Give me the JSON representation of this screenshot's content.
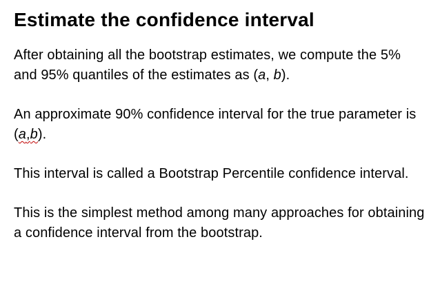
{
  "title": "Estimate the confidence interval",
  "paragraphs": {
    "p1": {
      "before": "After obtaining all the bootstrap estimates, we compute the 5% and 95% quantiles of the estimates as (",
      "var_a": "a",
      "sep": ", ",
      "var_b": "b",
      "after": ")."
    },
    "p2": {
      "before": "An approximate 90% confidence interval for the true parameter is (",
      "var_a": "a",
      "sep": ",",
      "var_b": "b",
      "after": ")."
    },
    "p3": {
      "text": "This interval is called a Bootstrap Percentile confidence interval."
    },
    "p4": {
      "text": "This is the simplest method among many approaches for obtaining a confidence interval from the bootstrap."
    }
  }
}
